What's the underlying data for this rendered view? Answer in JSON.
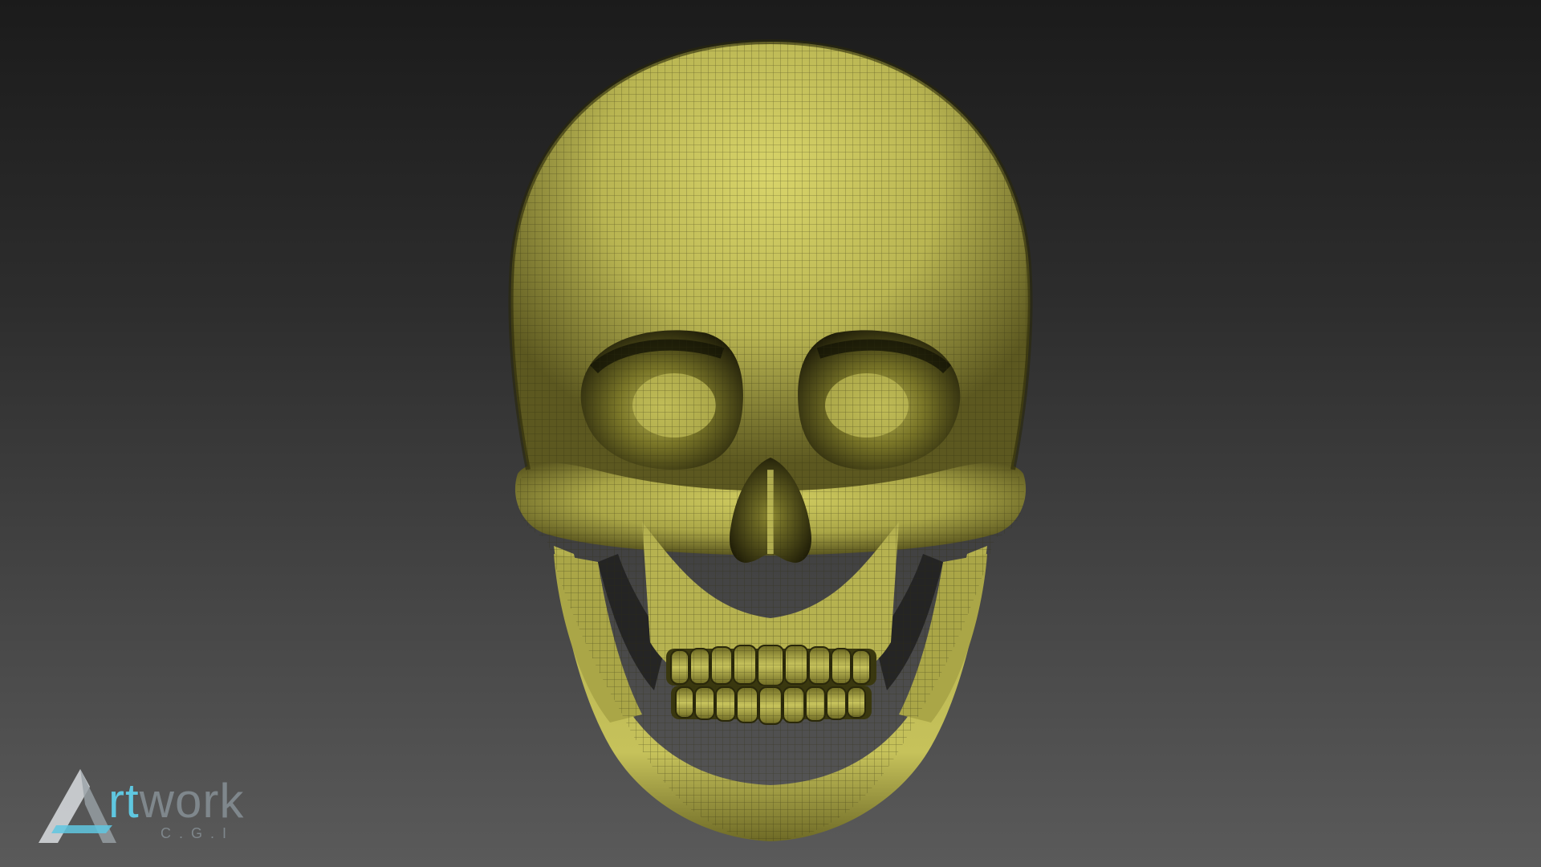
{
  "scene": {
    "subject": "skull",
    "background_top_color": "#1b1b1b",
    "background_bottom_color": "#5a5a5a",
    "mesh_color": "#b9b552",
    "mesh_highlight_color": "#d8d46a",
    "mesh_shadow_color": "#4a4716",
    "wireframe_color": "#2e2c0e"
  },
  "watermark": {
    "brand_part_accent": "rt",
    "brand_part_rest": "work",
    "sub_label": "C.G.I",
    "accent_color": "#5fc7e0",
    "icon": "triangle-a-logo-icon"
  }
}
